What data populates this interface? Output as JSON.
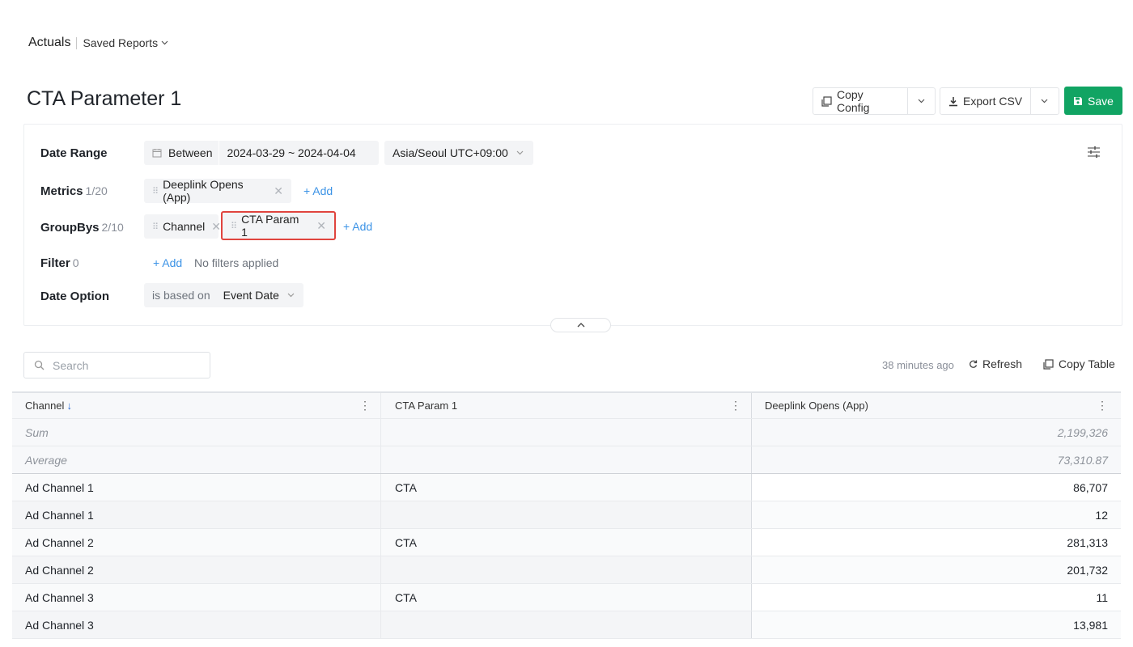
{
  "breadcrumb": {
    "app": "Actuals",
    "saved_reports": "Saved Reports"
  },
  "report_title": "CTA Parameter 1",
  "toolbar": {
    "copy_config": "Copy Config",
    "export_csv": "Export CSV",
    "save": "Save"
  },
  "config": {
    "date_range": {
      "label": "Date Range",
      "mode": "Between",
      "range": "2024-03-29 ~ 2024-04-04",
      "timezone": "Asia/Seoul UTC+09:00"
    },
    "metrics": {
      "label": "Metrics",
      "count": "1/20",
      "items": [
        "Deeplink Opens (App)"
      ],
      "add": "+ Add"
    },
    "groupbys": {
      "label": "GroupBys",
      "count": "2/10",
      "items": [
        "Channel",
        "CTA Param 1"
      ],
      "add": "+ Add"
    },
    "filter": {
      "label": "Filter",
      "count": "0",
      "add": "+ Add",
      "status": "No filters applied"
    },
    "date_option": {
      "label": "Date Option",
      "prefix": "is based on",
      "value": "Event Date"
    }
  },
  "table_tools": {
    "search_placeholder": "Search",
    "updated": "38 minutes ago",
    "refresh": "Refresh",
    "copy_table": "Copy Table"
  },
  "table": {
    "columns": [
      "Channel",
      "CTA Param 1",
      "Deeplink Opens (App)"
    ],
    "sort_arrow": "↓",
    "sum": {
      "label": "Sum",
      "value": "2,199,326"
    },
    "average": {
      "label": "Average",
      "value": "73,310.87"
    },
    "rows": [
      {
        "channel": "Ad Channel 1",
        "cta": "CTA",
        "value": "86,707"
      },
      {
        "channel": "Ad Channel 1",
        "cta": "",
        "value": "12"
      },
      {
        "channel": "Ad Channel 2",
        "cta": "CTA",
        "value": "281,313"
      },
      {
        "channel": "Ad Channel 2",
        "cta": "",
        "value": "201,732"
      },
      {
        "channel": "Ad Channel 3",
        "cta": "CTA",
        "value": "11"
      },
      {
        "channel": "Ad Channel 3",
        "cta": "",
        "value": "13,981"
      }
    ]
  },
  "colors": {
    "accent": "#11a463",
    "link": "#3c93e6",
    "highlight": "#e0443e",
    "sort": "#2f6fd6"
  }
}
